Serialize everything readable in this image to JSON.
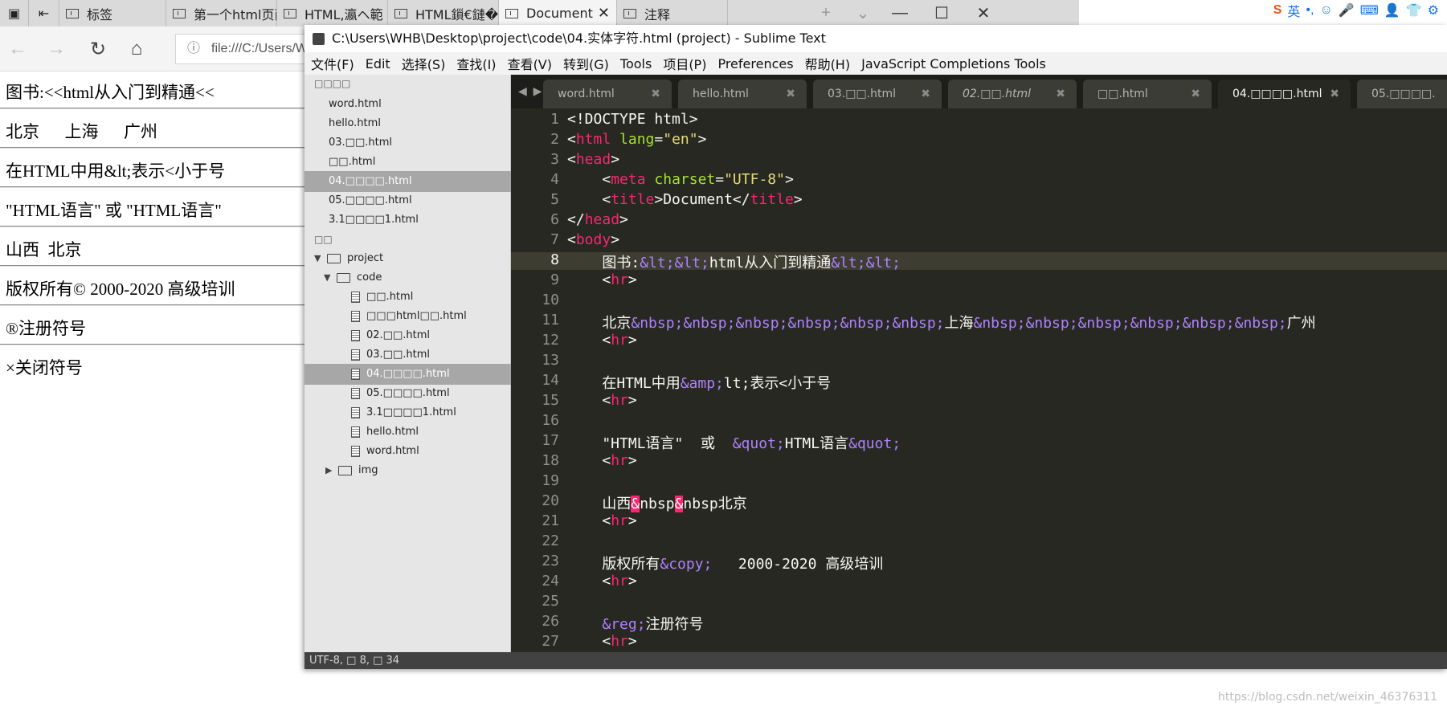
{
  "browser": {
    "tabs": [
      {
        "label": "标签"
      },
      {
        "label": "第一个html页面"
      },
      {
        "label": "HTML,瀛ヘ範"
      },
      {
        "label": "HTML鎻€鏈�"
      },
      {
        "label": "Document"
      },
      {
        "label": "注释"
      }
    ],
    "new_tab": "+",
    "tab_list": "⌄",
    "url": "file:///C:/Users/W",
    "controls": {
      "minimize": "—",
      "maximize": "☐",
      "close": "✕"
    }
  },
  "page": {
    "lines": [
      "图书:<<html从入门到精通<<",
      "北京      上海      广州",
      "在HTML中用&lt;表示<小于号",
      "\"HTML语言\" 或 \"HTML语言\"",
      "山西  北京",
      "版权所有© 2000-2020 高级培训",
      "®注册符号",
      "×关闭符号"
    ]
  },
  "sublime": {
    "title": "C:\\Users\\WHB\\Desktop\\project\\code\\04.实体字符.html (project) - Sublime Text",
    "menu": [
      "文件(F)",
      "Edit",
      "选择(S)",
      "查找(I)",
      "查看(V)",
      "转到(G)",
      "Tools",
      "项目(P)",
      "Preferences",
      "帮助(H)",
      "JavaScript Completions Tools"
    ],
    "sidebar": {
      "open_files_header": "□□□□",
      "open_files": [
        "word.html",
        "hello.html",
        "03.□□.html",
        "□□.html",
        "04.□□□□.html",
        "05.□□□□.html",
        "3.1□□□□1.html"
      ],
      "folders_header": "□□",
      "tree": [
        {
          "label": "project",
          "depth": 0,
          "type": "folder"
        },
        {
          "label": "code",
          "depth": 1,
          "type": "folder"
        },
        {
          "label": "□□.html",
          "depth": 2,
          "type": "file"
        },
        {
          "label": "□□□html□□.html",
          "depth": 2,
          "type": "file"
        },
        {
          "label": "02.□□.html",
          "depth": 2,
          "type": "file"
        },
        {
          "label": "03.□□.html",
          "depth": 2,
          "type": "file"
        },
        {
          "label": "04.□□□□.html",
          "depth": 2,
          "type": "file"
        },
        {
          "label": "05.□□□□.html",
          "depth": 2,
          "type": "file"
        },
        {
          "label": "3.1□□□□1.html",
          "depth": 2,
          "type": "file"
        },
        {
          "label": "hello.html",
          "depth": 2,
          "type": "file"
        },
        {
          "label": "word.html",
          "depth": 2,
          "type": "file"
        },
        {
          "label": "img",
          "depth": 1,
          "type": "folder-collapsed"
        }
      ]
    },
    "tabs": [
      "word.html",
      "hello.html",
      "03.□□.html",
      "02.□□.html",
      "□□.html",
      "04.□□□□.html",
      "05.□□□□."
    ],
    "active_tab": "04.□□□□.html",
    "line_numbers": [
      "1",
      "2",
      "3",
      "4",
      "5",
      "6",
      "7",
      "8",
      "9",
      "10",
      "11",
      "12",
      "13",
      "14",
      "15",
      "16",
      "17",
      "18",
      "19",
      "20",
      "21",
      "22",
      "23",
      "24",
      "25",
      "26",
      "27"
    ],
    "current_line": "8",
    "status": "UTF-8, □ 8, □ 34"
  },
  "tray": [
    "英",
    "•,",
    "☺",
    "🎤",
    "⌨",
    "👤",
    "👕",
    "⚙"
  ],
  "watermark": "https://blog.csdn.net/weixin_46376311",
  "colors": {
    "editor_bg": "#272822",
    "tag": "#f92672",
    "attr": "#a6e22e",
    "string": "#e6db74",
    "entity": "#ae81ff"
  }
}
